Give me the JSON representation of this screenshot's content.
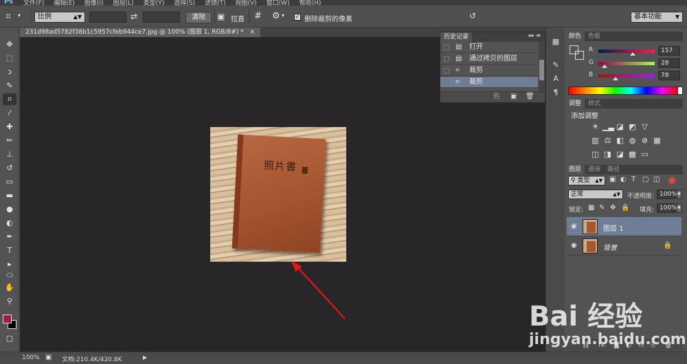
{
  "app": {
    "logo": "Ps",
    "menu": [
      "文件(F)",
      "编辑(E)",
      "图像(I)",
      "图层(L)",
      "类型(Y)",
      "选择(S)",
      "滤镜(T)",
      "视图(V)",
      "窗口(W)",
      "帮助(H)"
    ]
  },
  "options": {
    "ratio_select": "比例",
    "clear_button": "清除",
    "straighten_label": "拉直",
    "delete_cropped_label": "删除裁剪的像素",
    "delete_cropped_checked": true,
    "workspace_select": "基本功能"
  },
  "document": {
    "tab_title": "231d98ad5782f38b1c5957cfeb944ce7.jpg @ 100% (图层 1, RGB/8#) *",
    "close": "×",
    "book_title": "照片書"
  },
  "tools": [
    {
      "icon": "move-icon",
      "glyph": "✥"
    },
    {
      "icon": "marquee-icon",
      "glyph": "⬚"
    },
    {
      "icon": "lasso-icon",
      "glyph": "ↄ"
    },
    {
      "icon": "quick-select-icon",
      "glyph": "✎"
    },
    {
      "icon": "crop-icon",
      "glyph": "⌗"
    },
    {
      "icon": "eyedropper-icon",
      "glyph": "⁄"
    },
    {
      "icon": "healing-brush-icon",
      "glyph": "✚"
    },
    {
      "icon": "brush-icon",
      "glyph": "✏"
    },
    {
      "icon": "clone-stamp-icon",
      "glyph": "⊥"
    },
    {
      "icon": "history-brush-icon",
      "glyph": "↺"
    },
    {
      "icon": "eraser-icon",
      "glyph": "▭"
    },
    {
      "icon": "gradient-icon",
      "glyph": "▬"
    },
    {
      "icon": "blur-icon",
      "glyph": "●"
    },
    {
      "icon": "dodge-icon",
      "glyph": "◐"
    },
    {
      "icon": "pen-icon",
      "glyph": "✒"
    },
    {
      "icon": "type-icon",
      "glyph": "T"
    },
    {
      "icon": "path-select-icon",
      "glyph": "▸"
    },
    {
      "icon": "shape-icon",
      "glyph": "⬭"
    },
    {
      "icon": "hand-icon",
      "glyph": "✋"
    },
    {
      "icon": "zoom-icon",
      "glyph": "⚲"
    }
  ],
  "colors": {
    "foreground": "#9d1c4e",
    "background": "#000000"
  },
  "history": {
    "tab": "历史记录",
    "items": [
      {
        "label": "打开",
        "icon": "document-icon",
        "glyph": "▤"
      },
      {
        "label": "通过拷贝的图层",
        "icon": "document-icon",
        "glyph": "▤"
      },
      {
        "label": "裁剪",
        "icon": "crop-icon",
        "glyph": "⌗"
      },
      {
        "label": "裁剪",
        "icon": "crop-icon",
        "glyph": "⌗"
      }
    ]
  },
  "color_panel": {
    "tabs": [
      "颜色",
      "色板"
    ],
    "channels": [
      {
        "name": "R",
        "value": "157"
      },
      {
        "name": "G",
        "value": "28"
      },
      {
        "name": "B",
        "value": "78"
      }
    ]
  },
  "adjust_panel": {
    "tabs": [
      "调整",
      "样式"
    ],
    "heading": "添加调整"
  },
  "layers_panel": {
    "tabs": [
      "图层",
      "通道",
      "路径"
    ],
    "filter_select": "类型",
    "blend_select": "正常",
    "opacity_label": "不透明度:",
    "opacity_value": "100%",
    "lock_label": "锁定:",
    "fill_label": "填充:",
    "fill_value": "100%",
    "layers": [
      {
        "name": "图层 1",
        "selected": true,
        "locked": false
      },
      {
        "name": "背景",
        "selected": false,
        "locked": true
      }
    ]
  },
  "status": {
    "zoom": "100%",
    "doc_size": "文档:210.4K/420.8K"
  },
  "watermark": {
    "logo": "Bai 经验",
    "url": "jingyan.baidu.com"
  }
}
